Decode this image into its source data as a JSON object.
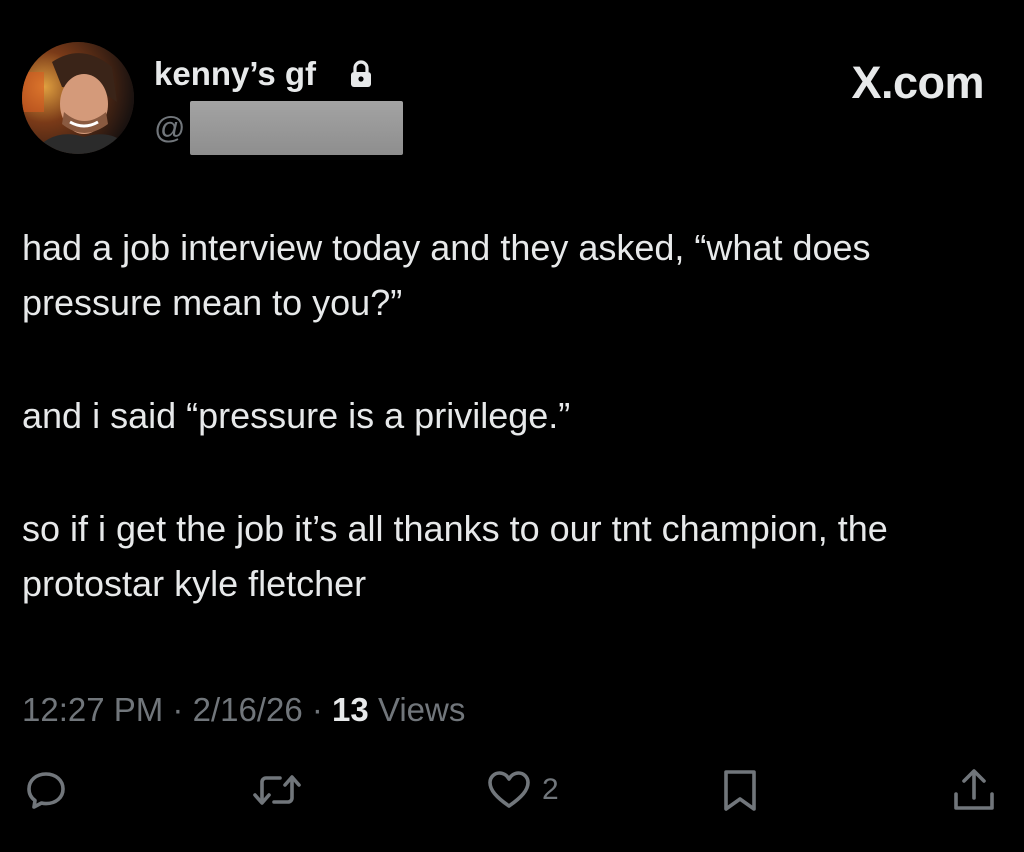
{
  "author": {
    "display_name": "kenny’s gf",
    "handle_prefix": "@",
    "protected_icon": "lock-icon",
    "avatar": "profile-photo"
  },
  "brand": "X.com",
  "tweet": {
    "paragraphs": [
      "had a job interview today and they asked, “what does pressure mean to you?”",
      "and i said “pressure is a privilege.”",
      "so if i get the job it’s all thanks to our tnt champion, the protostar kyle fletcher"
    ]
  },
  "meta": {
    "time": "12:27 PM",
    "separator": "·",
    "date": "2/16/26",
    "views_count": "13",
    "views_label": "Views"
  },
  "actions": {
    "reply_icon": "reply-icon",
    "repost_icon": "repost-icon",
    "like_icon": "heart-icon",
    "like_count": "2",
    "bookmark_icon": "bookmark-icon",
    "share_icon": "share-icon"
  },
  "colors": {
    "background": "#000000",
    "text_primary": "#e7e9ea",
    "text_secondary": "#71767b"
  }
}
